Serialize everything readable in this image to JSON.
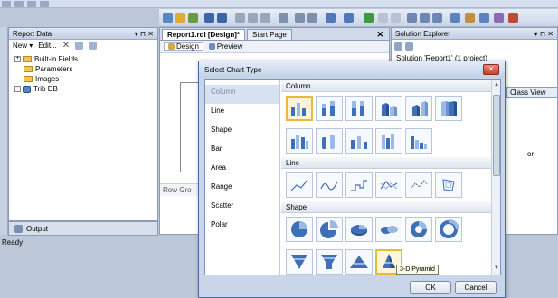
{
  "report_data": {
    "title": "Report Data",
    "pin": "— \u0001 ×",
    "new_label": "New ▾",
    "edit_label": "Edit...",
    "delete_glyph": "✕",
    "tree": [
      {
        "label": "Built-in Fields",
        "expand": "+",
        "icon": "folder-icon"
      },
      {
        "label": "Parameters",
        "expand": "",
        "icon": "folder-icon"
      },
      {
        "label": "Images",
        "expand": "",
        "icon": "folder-icon"
      },
      {
        "label": "Trib DB",
        "expand": "−",
        "icon": "database-icon"
      }
    ]
  },
  "doc": {
    "tab1": "Report1.rdl [Design]*",
    "tab2": "Start Page",
    "close": "✕",
    "design": "Design",
    "preview": "Preview",
    "row_groups": "Row Gro"
  },
  "solution_explorer": {
    "title": "Solution Explorer",
    "close": "✕",
    "class_view": "Class View",
    "item1": "Solution 'Report1' (1 project)",
    "item2": "or"
  },
  "output": {
    "label": "Output"
  },
  "status": {
    "text": "Ready"
  },
  "dialog": {
    "title": "Select Chart Type",
    "close": "✕",
    "categories": [
      "Column",
      "Line",
      "Shape",
      "Bar",
      "Area",
      "Range",
      "Scatter",
      "Polar"
    ],
    "selected_category": "Column",
    "sections": {
      "column": "Column",
      "line": "Line",
      "shape": "Shape"
    },
    "tooltip": "3-D Pyramid",
    "ok": "OK",
    "cancel": "Cancel"
  },
  "colors": {
    "accent": "#e9b93a",
    "series_blue": "#3f6fb6",
    "series_light": "#9bb9e6"
  }
}
